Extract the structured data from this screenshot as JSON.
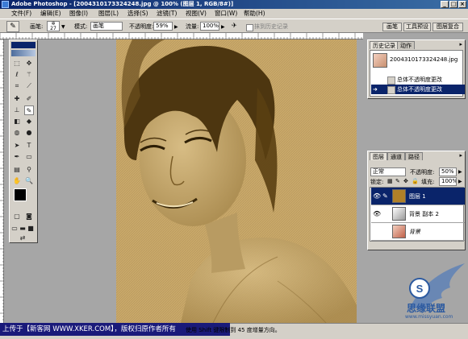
{
  "window": {
    "title": "Adobe Photoshop - [2004310173324248.jpg @ 100% (图层 1, RGB/8#)]",
    "controls": [
      "_",
      "□",
      "×"
    ]
  },
  "menu": [
    "文件(F)",
    "编辑(E)",
    "图像(I)",
    "图层(L)",
    "选择(S)",
    "滤镜(T)",
    "视图(V)",
    "窗口(W)",
    "帮助(H)"
  ],
  "options_bar": {
    "brush_label": "画笔:",
    "brush_size": "27",
    "mode_label": "模式:",
    "mode_value": "画笔",
    "opacity_label": "不透明度:",
    "opacity_value": "59%",
    "flow_label": "流量:",
    "flow_value": "100%",
    "erase_history_label": "抹到历史记录",
    "tabs": [
      "画笔",
      "工具预设",
      "图层复合"
    ]
  },
  "history_panel": {
    "tabs": [
      "历史记录",
      "动作"
    ],
    "snapshot_name": "2004310173324248.jpg",
    "steps": [
      "总体不透明度更改",
      "总体不透明度更改"
    ]
  },
  "layers_panel": {
    "tabs": [
      "图层",
      "通道",
      "路径"
    ],
    "blend_mode": "正常",
    "opacity_label": "不透明度:",
    "opacity_value": "50%",
    "lock_label": "锁定:",
    "fill_label": "填充:",
    "fill_value": "100%",
    "layers": [
      {
        "name": "图层 1",
        "selected": true,
        "visible": true
      },
      {
        "name": "背景 副本 2",
        "selected": false,
        "visible": true
      },
      {
        "name": "背景",
        "selected": false,
        "visible": false
      }
    ]
  },
  "statusbar": {
    "banner_text": "上传于【新客网 WWW.XKER.COM】，版权归原作者所有",
    "hint_text": "使用 Shift 键限制到 45 度增量方向。"
  },
  "watermark": {
    "logo_text": "思缘联盟",
    "url_text": "www.missyuan.com"
  },
  "colors": {
    "canvas_bg": "#c9a96a",
    "canvas_ink": "#5b3f10",
    "layer_fill": "#b08028",
    "selection": "#0a246a",
    "titlebar": "#0a246a"
  }
}
